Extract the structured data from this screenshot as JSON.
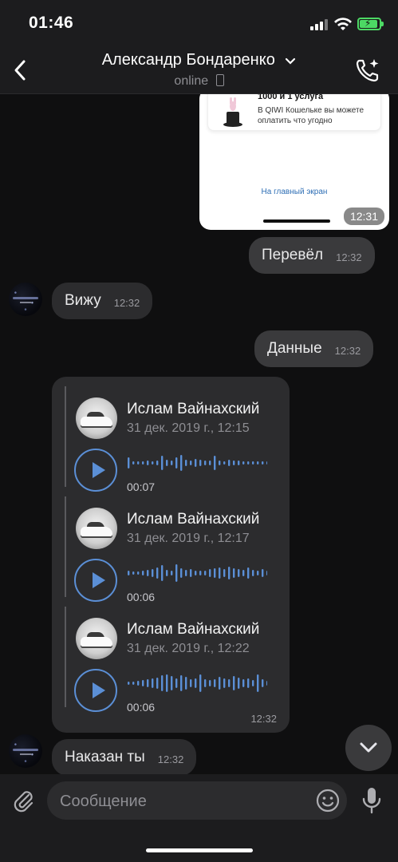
{
  "status_bar": {
    "time": "01:46",
    "icons": [
      "signal-icon",
      "wifi-icon",
      "battery-charging-icon"
    ],
    "battery_color": "#4cd964"
  },
  "header": {
    "title": "Александр Бондаренко",
    "subtitle": "online",
    "icons": [
      "back-chevron-icon",
      "chevron-down-icon",
      "mobile-icon",
      "call-settings-icon"
    ]
  },
  "messages": {
    "image": {
      "card_title": "1000 и 1 услуга",
      "card_text": "В QIWI Кошельке вы можете оплатить что угодно",
      "link": "На главный экран",
      "time": "12:31"
    },
    "m1": {
      "text": "Перевёл",
      "time": "12:32",
      "direction": "outgoing"
    },
    "m2": {
      "text": "Вижу",
      "time": "12:32",
      "direction": "incoming"
    },
    "m3": {
      "text": "Данные",
      "time": "12:32",
      "direction": "outgoing"
    },
    "forwarded": {
      "time": "12:32",
      "items": [
        {
          "name": "Ислам Вайнахский",
          "date": "31 дек. 2019 г., 12:15",
          "duration": "00:07"
        },
        {
          "name": "Ислам Вайнахский",
          "date": "31 дек. 2019 г., 12:17",
          "duration": "00:06"
        },
        {
          "name": "Ислам Вайнахский",
          "date": "31 дек. 2019 г., 12:22",
          "duration": "00:06"
        }
      ]
    },
    "m4": {
      "text": "Наказан ты",
      "time": "12:32",
      "direction": "incoming"
    }
  },
  "composer": {
    "placeholder": "Сообщение",
    "icons": [
      "paperclip-icon",
      "emoji-icon",
      "microphone-icon"
    ]
  },
  "colors": {
    "accent": "#5b8fd6",
    "bubble_in": "#2c2c2e",
    "bubble_out": "#3a3a3c",
    "background": "#0f0f10"
  }
}
